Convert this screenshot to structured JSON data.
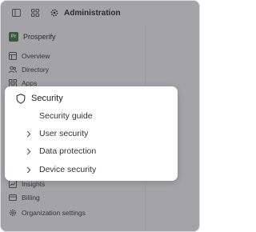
{
  "topbar": {
    "title": "Administration",
    "sidebar_toggle_icon": "sidebar-panel-icon",
    "apps_grid_icon": "apps-grid-icon",
    "settings_icon": "gear-icon"
  },
  "sidebar": {
    "org_name": "Prosperify",
    "org_logo_initials": "Pr",
    "org_logo_color": "#2f7d2f",
    "items": [
      {
        "label": "Overview",
        "icon": "overview-icon"
      },
      {
        "label": "Directory",
        "icon": "people-icon"
      },
      {
        "label": "Apps",
        "icon": "apps-icon"
      },
      {
        "label": "Insights",
        "icon": "insights-icon"
      },
      {
        "label": "Billing",
        "icon": "billing-icon"
      },
      {
        "label": "Organization settings",
        "icon": "gear-icon"
      }
    ]
  },
  "popover": {
    "title": "Security",
    "icon": "shield-icon",
    "items": [
      {
        "label": "Security guide",
        "expandable": false
      },
      {
        "label": "User security",
        "expandable": true
      },
      {
        "label": "Data protection",
        "expandable": true
      },
      {
        "label": "Device security",
        "expandable": true
      }
    ]
  }
}
